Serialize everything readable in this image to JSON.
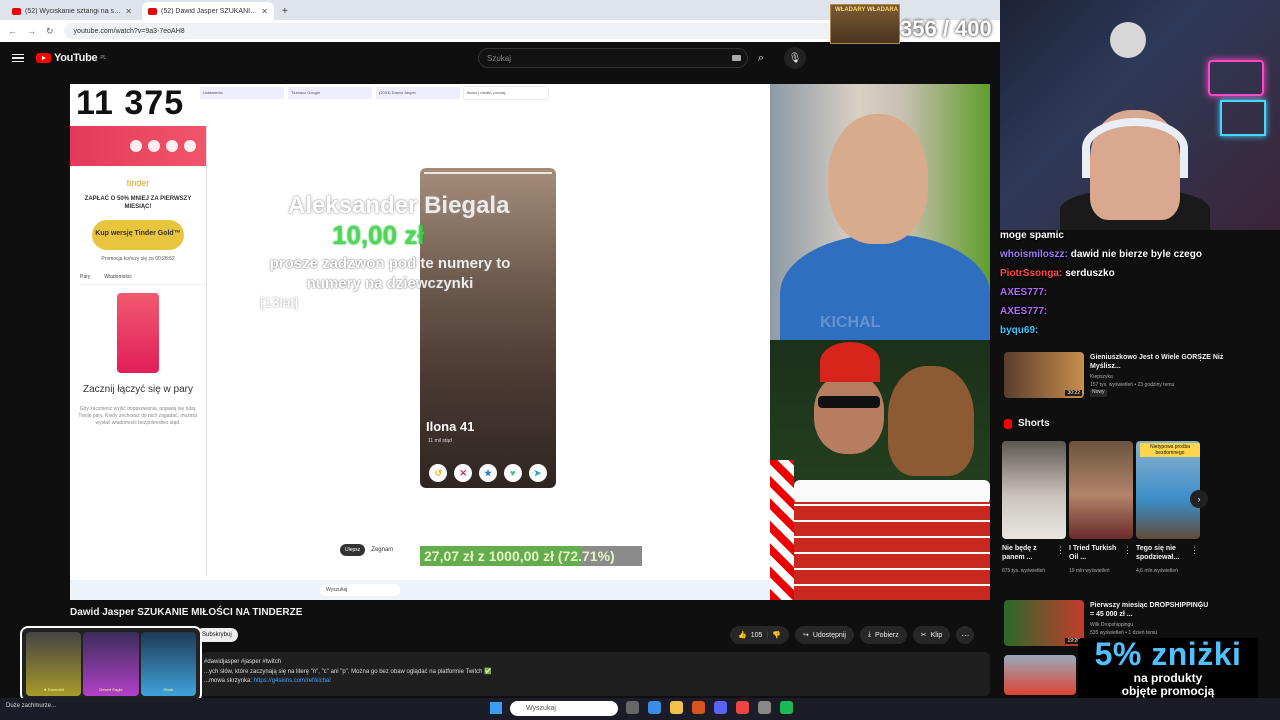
{
  "browser": {
    "tabs": [
      {
        "title": "(52) Wyciskanie sztangi na stoj...",
        "active": false
      },
      {
        "title": "(52) Dawid Jasper SZUKANIE...",
        "active": true
      }
    ],
    "url": "youtube.com/watch?v=9a3-7eoAH8"
  },
  "header": {
    "logo": "YouTube",
    "logo_region": "PL",
    "search_placeholder": "Szukaj"
  },
  "stream_overlay": {
    "counter": "11 375",
    "goal_counter": "356 / 400",
    "wladary_label": "WŁADARY WŁADARA",
    "donor_name": "Aleksander Biegala",
    "donation_amount": "10,00 zł",
    "donation_message": "prosze zadzwon pod te numery to numery na dziewczynki",
    "donation_age": "[13lat]",
    "progress_text": "27,07 zł z 1000,00 zł (72.71%)",
    "progress_fraction": 0.7271,
    "cam_watermark": "KICHAL"
  },
  "inner_browser": {
    "tabs": [
      "Ustawienia",
      "Tłumacz Google",
      "(2003) Dawid Jasper",
      "tinder | randki, poznaj..."
    ],
    "tinder_logo": "tinder",
    "tinder_promo": "ZAPŁAĆ O 50% MNIEJ ZA PIERWSZY MIESIĄC!",
    "gold_button": "Kup wersję Tinder Gold™",
    "promo_timer": "Promocja kończy się za 00:28:52",
    "tab_pary": "Pary",
    "tab_wiadomosci": "Wiadomości",
    "start_title": "Zacznij łączyć się w pary",
    "start_sub": "Gdy zaczniesz wyjść dopasowania, pojawią się tutaj. Twoje pary. Kiedy zechcesz do nich zagadać, możesz wysłać wiadomość bezpośrednio stąd.",
    "profile_name": "Ilona 41",
    "profile_distance": "11 mil stąd",
    "bottom_pill": "Ulepsz",
    "bottom_label": "Zegnam",
    "taskbar_search": "Wyszukaj"
  },
  "video": {
    "title": "Dawid Jasper SZUKANIE MIŁOŚCI NA TINDERZE",
    "subscribe_label": "Subskrybuj",
    "likes": "105",
    "share_label": "Udostępnij",
    "download_label": "Pobierz",
    "clip_label": "Klip",
    "description_tags": "#dawidjasper #jasper #twitch",
    "description_line": "...ych słów, które zaczynają się na literę \"n\", \"c\" ani \"p\". Można go bez obaw oglądać na platformie Twitch ✅",
    "description_link_label": "...mowa skrzynka:",
    "description_link": "https://g4skins.com/ref/kichal",
    "promo_items": [
      "★ Karambit",
      "Desert Eagle",
      "Glock"
    ]
  },
  "chat": {
    "header": "moge spamic",
    "messages": [
      {
        "user": "whoismiloszz:",
        "text": "dawid nie bierze byle czego"
      },
      {
        "user": "PiotrSsonga:",
        "text": "serduszko"
      },
      {
        "user": "AXES777:",
        "text": ""
      },
      {
        "user": "AXES777:",
        "text": ""
      },
      {
        "user": "byqu69:",
        "text": ""
      }
    ]
  },
  "related": [
    {
      "title": "Gieniuszkowo Jest o Wiele GORSZE Niż Myślisz...",
      "channel": "Kiepszyka",
      "meta": "157 tys. wyświetleń • 23 godziny temu",
      "badge": "Nowy",
      "duration": "30:22"
    },
    {
      "title": "Pierwszy miesiąc DROPSHIPPINGU = 45 000 zł ...",
      "channel": "Wilk Dropshippingu",
      "meta": "535 wyświetleń • 1 dzień temu",
      "badge": "",
      "duration": "19:20"
    }
  ],
  "shorts": {
    "heading": "Shorts",
    "badge": "Nietypowa prośba bezdomnego",
    "items": [
      {
        "title": "Nie będę z panem ...",
        "views": "875 tys. wyświetleń"
      },
      {
        "title": "I Tried Turkish Oil ...",
        "views": "19 mln wyświetleń"
      },
      {
        "title": "Tego się nie spodziewał...",
        "views": "4,6 mln wyświetleń"
      }
    ]
  },
  "promo_banner": {
    "big": "5% zniżki",
    "line1": "na produkty",
    "line2": "objęte promocją"
  },
  "taskbar": {
    "weather": "Duże zachmurze...",
    "search": "Wyszukaj"
  }
}
